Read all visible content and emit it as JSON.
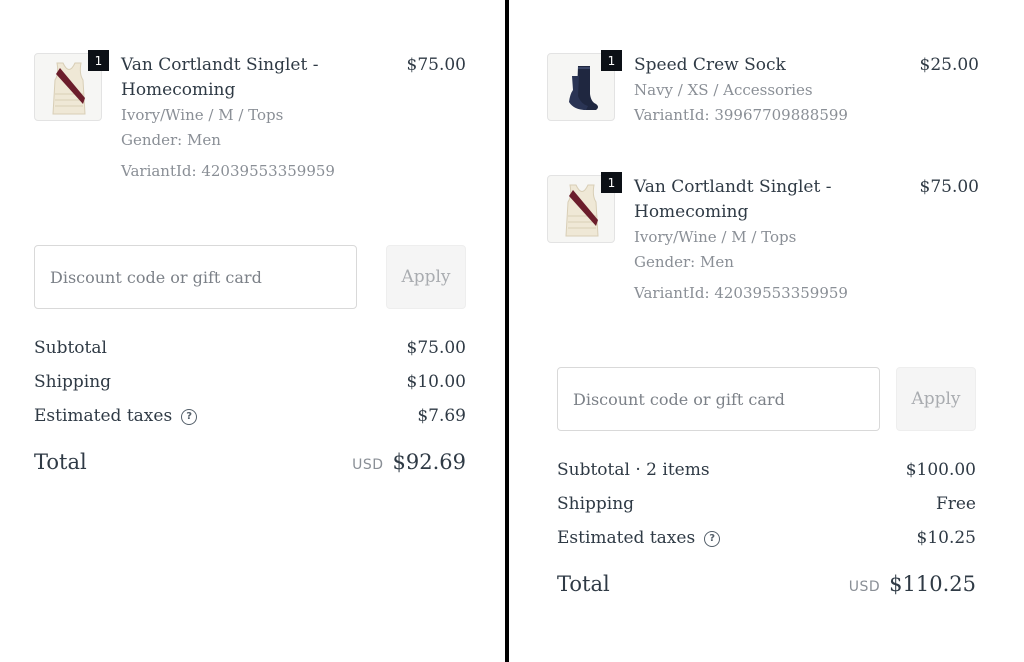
{
  "left_panel": {
    "items": [
      {
        "quantity": "1",
        "name_line1": "Van Cortlandt Singlet -",
        "name_line2": "Homecoming",
        "options": "Ivory/Wine / M / Tops",
        "gender": "Gender: Men",
        "variant": "VariantId: 42039553359959",
        "price": "$75.00",
        "icon": "singlet-thumbnail"
      }
    ],
    "discount": {
      "placeholder": "Discount code or gift card",
      "apply_label": "Apply"
    },
    "summary": {
      "subtotal_label": "Subtotal",
      "subtotal_value": "$75.00",
      "shipping_label": "Shipping",
      "shipping_value": "$10.00",
      "taxes_label": "Estimated taxes",
      "taxes_value": "$7.69",
      "help_icon": "question-circle-icon",
      "help_glyph": "?"
    },
    "total": {
      "label": "Total",
      "currency": "USD",
      "amount": "$92.69"
    }
  },
  "right_panel": {
    "items": [
      {
        "quantity": "1",
        "name_line1": "Speed Crew Sock",
        "options": "Navy / XS / Accessories",
        "variant": "VariantId: 39967709888599",
        "price": "$25.00",
        "icon": "sock-thumbnail"
      },
      {
        "quantity": "1",
        "name_line1": "Van Cortlandt Singlet -",
        "name_line2": "Homecoming",
        "options": "Ivory/Wine / M / Tops",
        "gender": "Gender: Men",
        "variant": "VariantId: 42039553359959",
        "price": "$75.00",
        "icon": "singlet-thumbnail"
      }
    ],
    "discount": {
      "placeholder": "Discount code or gift card",
      "apply_label": "Apply"
    },
    "summary": {
      "subtotal_label": "Subtotal · 2 items",
      "subtotal_value": "$100.00",
      "shipping_label": "Shipping",
      "shipping_value": "Free",
      "taxes_label": "Estimated taxes",
      "taxes_value": "$10.25",
      "help_icon": "question-circle-icon",
      "help_glyph": "?"
    },
    "total": {
      "label": "Total",
      "currency": "USD",
      "amount": "$110.25"
    }
  },
  "colors": {
    "text": "#2f3a45",
    "muted": "#8a8f96",
    "badge": "#0c1016",
    "divider": "#000000",
    "singlet_body": "#efe8d6",
    "singlet_sash": "#6b1d2b",
    "sock": "#1f2740"
  }
}
